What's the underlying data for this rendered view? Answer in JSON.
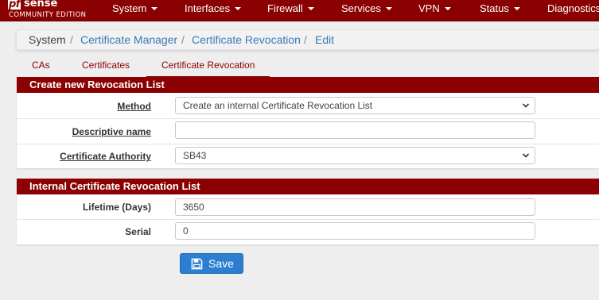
{
  "brand": {
    "logo_pf": "pf",
    "logo_sense": "sense",
    "edition": "COMMUNITY EDITION"
  },
  "nav": {
    "items": [
      "System",
      "Interfaces",
      "Firewall",
      "Services",
      "VPN",
      "Status",
      "Diagnostics"
    ]
  },
  "breadcrumb": {
    "items": [
      "System",
      "Certificate Manager",
      "Certificate Revocation",
      "Edit"
    ],
    "separator": "/"
  },
  "tabs": {
    "items": [
      "CAs",
      "Certificates",
      "Certificate Revocation"
    ],
    "active": "Certificate Revocation"
  },
  "create_panel": {
    "title": "Create new Revocation List",
    "method_label": "Method",
    "method_value": "Create an internal Certificate Revocation List",
    "descr_label": "Descriptive name",
    "descr_value": "",
    "ca_label": "Certificate Authority",
    "ca_value": "SB43"
  },
  "internal_panel": {
    "title": "Internal Certificate Revocation List",
    "lifetime_label": "Lifetime (Days)",
    "lifetime_value": "3650",
    "serial_label": "Serial",
    "serial_value": "0"
  },
  "actions": {
    "save_label": "Save"
  },
  "colors": {
    "brand_red": "#8b0000",
    "primary_blue": "#2c7ed0",
    "link_blue": "#3a7ab8"
  },
  "icons": {
    "save": "floppy-disk-icon",
    "dropdown": "chevron-down-icon",
    "nav_caret": "caret-down-icon"
  }
}
